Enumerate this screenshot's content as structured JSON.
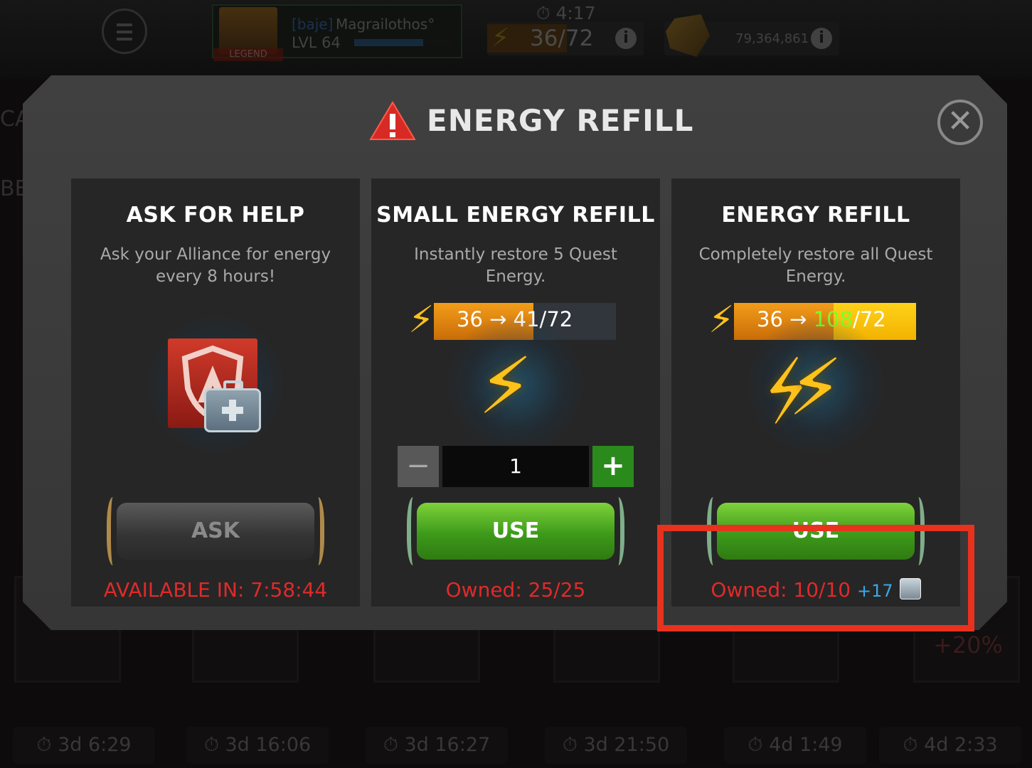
{
  "hud": {
    "alliance_tag": "[baje]",
    "player_name": "Magrailothos°",
    "player_level": "LVL 64",
    "legend_tag": "LEGEND",
    "xp_progress": 0.7,
    "timer": "4:17",
    "energy_current": "36",
    "energy_max": "72",
    "energy_display": "36/72",
    "gold": "79,364,861",
    "side_text_left_1": "CA",
    "side_text_left_2": "BE",
    "bonus_text": "+20%"
  },
  "background_timers": [
    "3d 6:29",
    "3d 16:06",
    "3d 16:27",
    "3d 21:50",
    "4d 1:49",
    "4d 2:33"
  ],
  "modal": {
    "title": "ENERGY REFILL",
    "close_icon": "close-icon"
  },
  "panels": {
    "ask": {
      "title": "ASK FOR HELP",
      "description": "Ask your Alliance for energy every 8 hours!",
      "button_label": "ASK",
      "footer": "AVAILABLE IN: 7:58:44"
    },
    "small": {
      "title": "SMALL ENERGY REFILL",
      "description": "Instantly restore 5 Quest Energy.",
      "bar_from": "36",
      "bar_arrow": "→",
      "bar_to": "41/72",
      "quantity": "1",
      "minus": "−",
      "plus": "+",
      "button_label": "USE",
      "footer": "Owned: 25/25"
    },
    "full": {
      "title": "ENERGY REFILL",
      "description": "Completely restore all Quest Energy.",
      "bar_from": "36",
      "bar_arrow": "→",
      "bar_to_gain": "108",
      "bar_to_max": "/72",
      "button_label": "USE",
      "footer": "Owned: 10/10",
      "bonus": "+17"
    }
  },
  "colors": {
    "accent_red": "#e02a2a",
    "highlight": "#e8321e",
    "green_button": "#3d9a1a",
    "energy_orange": "#f39d1a",
    "bonus_blue": "#3aa8e8"
  }
}
